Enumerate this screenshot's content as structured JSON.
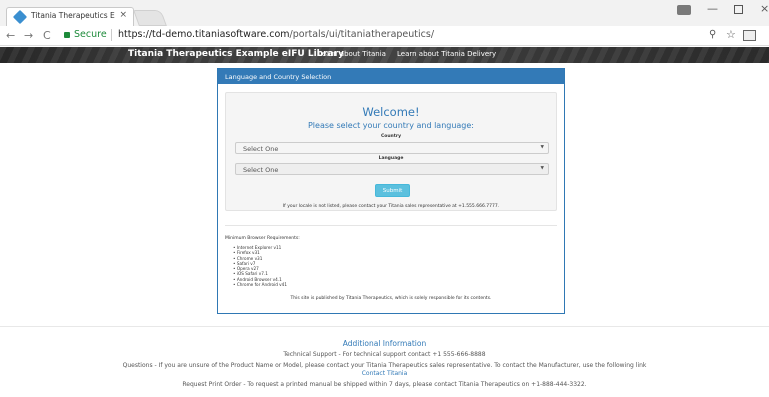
{
  "browser": {
    "tab_title": "Titania Therapeutics Exa",
    "tab_close": "×",
    "secure_label": "Secure",
    "url_host": "https://td-demo.titaniasoftware.com",
    "url_path": "/portals/ui/titaniatherapeutics/",
    "nav_back": "←",
    "nav_forward": "→",
    "nav_reload": "C",
    "win_minimize": "—",
    "win_close": "×",
    "zoom_glyph": "⚲",
    "star_glyph": "☆"
  },
  "banner": {
    "title": "Titania Therapeutics Example eIFU Library",
    "link_titania": "Learn about Titania",
    "link_delivery": "Learn about Titania Delivery"
  },
  "panel": {
    "heading": "Language and Country Selection",
    "welcome": "Welcome!",
    "subtitle": "Please select your country and language:",
    "country_label": "Country",
    "country_value": "Select One",
    "language_label": "Language",
    "language_value": "Select One",
    "submit_label": "Submit",
    "notice": "If your locale is not listed, please contact your Titania sales representative at +1.555.666.7777.",
    "requirements_title": "Minimum Browser Requirements:",
    "requirements": [
      "Internet Explorer v11",
      "Firefox v31",
      "Chrome v31",
      "Safari v7",
      "Opera v27",
      "iOS Safari v7.1",
      "Android Browser v4.1",
      "Chrome for Android v41"
    ],
    "published_note": "This site is published by Titania Therapeutics, which is solely responsible for its contents."
  },
  "footer": {
    "heading": "Additional Information",
    "tech_support": "Technical Support - For technical support contact +1 555-666-8888",
    "questions": "Questions - If you are unsure of the Product Name or Model, please contact your Titania Therapeutics sales representative. To contact the Manufacturer, use the following link",
    "contact_link": "Contact Titania",
    "print_order": "Request Print Order - To request a printed manual be shipped within 7 days, please contact Titania Therapeutics on +1-888-444-3322."
  },
  "colors": {
    "accent": "#337ab7",
    "submit": "#5bc0de",
    "secure_green": "#1d8a3a"
  },
  "icons": [
    "diamond-favicon-icon",
    "close-icon",
    "back-arrow-icon",
    "forward-arrow-icon",
    "reload-icon",
    "lock-icon",
    "zoom-icon",
    "star-icon",
    "extension-icon",
    "chevron-down-icon"
  ]
}
